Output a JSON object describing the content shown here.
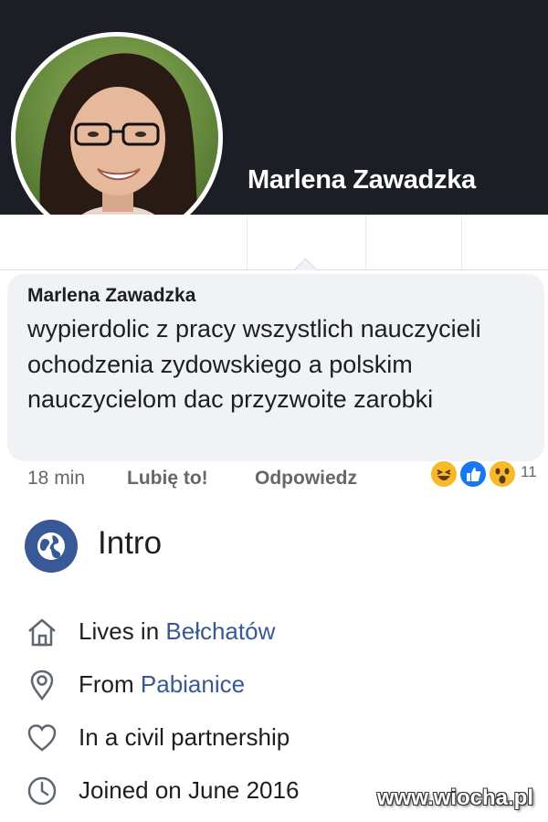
{
  "profile": {
    "name": "Marlena Zawadzka"
  },
  "comment": {
    "author": "Marlena Zawadzka",
    "text": "wypierdolic z pracy wszystlich nauczycieli ochodzenia zydowskiego a polskim nauczycielom dac przyzwoite zarobki",
    "time": "18 min",
    "like_label": "Lubię to!",
    "reply_label": "Odpowiedz",
    "reaction_count": "11",
    "reactions": [
      "haha-reaction-icon",
      "like-reaction-icon",
      "wow-reaction-icon"
    ]
  },
  "intro": {
    "title": "Intro",
    "icon": "globe-icon",
    "items": [
      {
        "icon": "home-icon",
        "prefix": "Lives in ",
        "link": "Bełchatów"
      },
      {
        "icon": "location-pin-icon",
        "prefix": "From ",
        "link": "Pabianice"
      },
      {
        "icon": "heart-icon",
        "prefix": "In a civil partnership",
        "link": ""
      },
      {
        "icon": "clock-icon",
        "prefix": "Joined on June 2016",
        "link": ""
      }
    ]
  },
  "watermark": "www.wiocha.pl",
  "colors": {
    "cover": "#1c1e26",
    "bubble": "#f0f2f5",
    "link": "#385898",
    "muted": "#65676b",
    "like_blue": "#1877f2",
    "reaction_yellow": "#f7b928"
  }
}
